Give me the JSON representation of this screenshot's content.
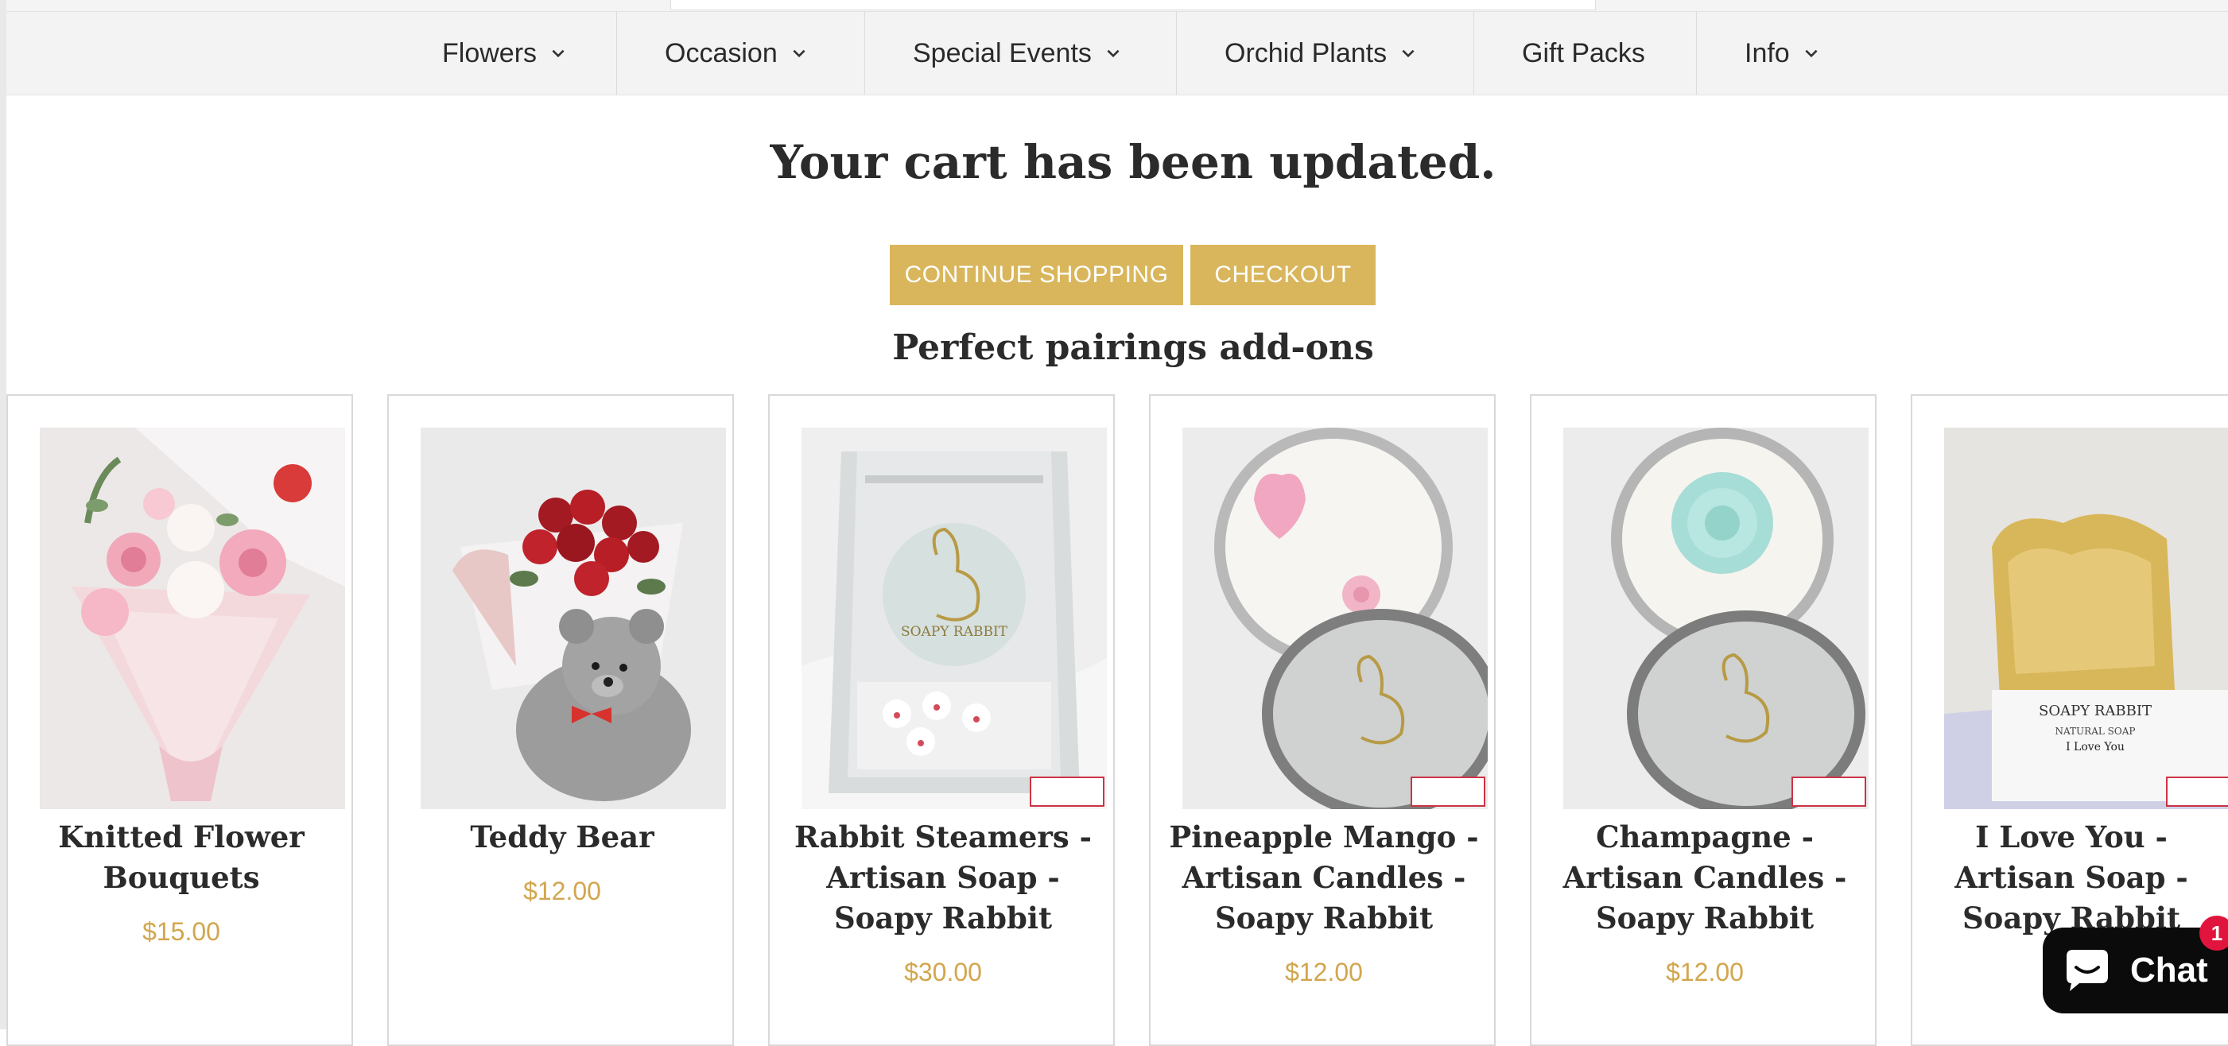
{
  "nav": {
    "items": [
      {
        "label": "Flowers",
        "has_dropdown": true
      },
      {
        "label": "Occasion",
        "has_dropdown": true
      },
      {
        "label": "Special Events",
        "has_dropdown": true
      },
      {
        "label": "Orchid Plants",
        "has_dropdown": true
      },
      {
        "label": "Gift Packs",
        "has_dropdown": false
      },
      {
        "label": "Info",
        "has_dropdown": true
      }
    ]
  },
  "cart": {
    "title": "Your cart has been updated.",
    "continue_label": "CONTINUE SHOPPING",
    "checkout_label": "CHECKOUT"
  },
  "pairings": {
    "heading": "Perfect pairings add-ons",
    "products": [
      {
        "name_lines": [
          "Knitted Flower",
          "Bouquets"
        ],
        "price": "$15.00",
        "image": "pink knitted flower bouquet"
      },
      {
        "name_lines": [
          "Teddy Bear"
        ],
        "price": "$12.00",
        "image": "grey teddy bear with red roses"
      },
      {
        "name_lines": [
          "Rabbit Steamers -",
          "Artisan Soap -",
          "Soapy Rabbit"
        ],
        "price": "$30.00",
        "image": "silver pouch with rabbit logo"
      },
      {
        "name_lines": [
          "Pineapple Mango -",
          "Artisan Candles -",
          "Soapy Rabbit"
        ],
        "price": "$12.00",
        "image": "candle tin with pink heart"
      },
      {
        "name_lines": [
          "Champagne -",
          "Artisan Candles -",
          "Soapy Rabbit"
        ],
        "price": "$12.00",
        "image": "candle tin with mint rose"
      },
      {
        "name_lines": [
          "I Love You -",
          "Artisan Soap -",
          "Soapy Rabbit"
        ],
        "price": "",
        "image": "heart shaped yellow soap"
      }
    ],
    "image_brand_text": {
      "bag": "SOAPY RABBIT",
      "soap_box": "SOAPY RABBIT",
      "soap_box_sub": "NATURAL SOAP",
      "soap_box_line": "I Love You"
    }
  },
  "chat": {
    "label": "Chat",
    "badge": "1"
  },
  "colors": {
    "accent": "#d9b65c",
    "price": "#d2a64d",
    "chat_bg": "#0b0b0b",
    "badge": "#e0143c"
  }
}
